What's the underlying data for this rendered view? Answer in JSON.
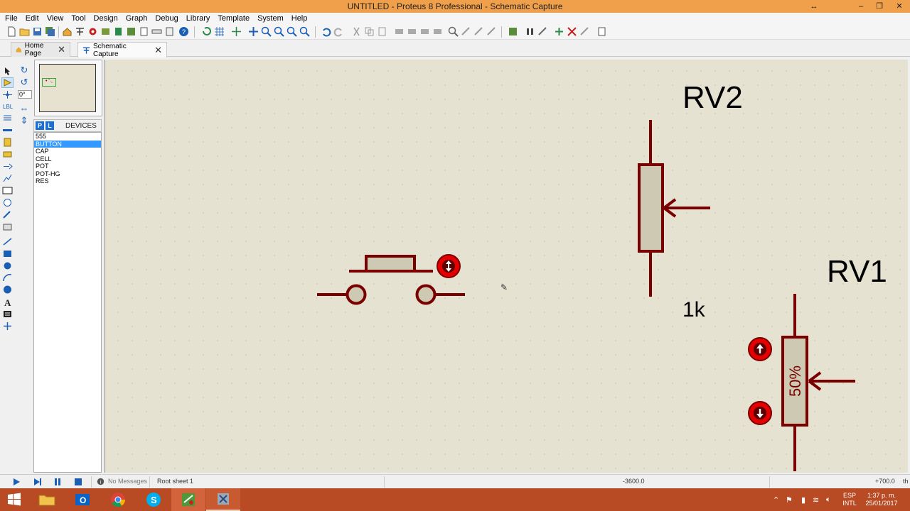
{
  "window": {
    "title": "UNTITLED - Proteus 8 Professional - Schematic Capture",
    "controls": [
      "↔",
      "–",
      "❐",
      "✕"
    ]
  },
  "menu": [
    "File",
    "Edit",
    "View",
    "Tool",
    "Design",
    "Graph",
    "Debug",
    "Library",
    "Template",
    "System",
    "Help"
  ],
  "tabs": [
    {
      "label": "Home Page",
      "active": false,
      "icon": "home-icon"
    },
    {
      "label": "Schematic Capture",
      "active": true,
      "icon": "schematic-icon"
    }
  ],
  "rotation": {
    "angle": "0°"
  },
  "overview": {
    "marker": "• '·,"
  },
  "devices": {
    "p_label": "P",
    "l_label": "L",
    "title": "DEVICES",
    "items": [
      {
        "label": "555",
        "selected": false
      },
      {
        "label": "BUTTON",
        "selected": true
      },
      {
        "label": "CAP",
        "selected": false
      },
      {
        "label": "CELL",
        "selected": false
      },
      {
        "label": "POT",
        "selected": false
      },
      {
        "label": "POT-HG",
        "selected": false
      },
      {
        "label": "RES",
        "selected": false
      }
    ]
  },
  "schematic": {
    "rv2_ref": "RV2",
    "rv2_value": "1k",
    "rv1_ref": "RV1",
    "rv1_setting": "50%",
    "colors": {
      "wire": "#7a0000",
      "body": "#cdc9b3",
      "knob": "#e30000",
      "canvas": "#e6e2d2"
    }
  },
  "status": {
    "messages": "No Messages",
    "sheet": "Root sheet 1",
    "coord_x": "-3600.0",
    "coord_y": "+700.0",
    "unit": "th"
  },
  "taskbar": {
    "apps": [
      "windows-start-icon",
      "file-explorer-icon",
      "outlook-icon",
      "chrome-icon",
      "skype-icon",
      "proteus-isis-icon",
      "proteus-icon"
    ],
    "lang_top": "ESP",
    "lang_bottom": "INTL",
    "time": "1:37 p. m.",
    "date": "25/01/2017"
  }
}
